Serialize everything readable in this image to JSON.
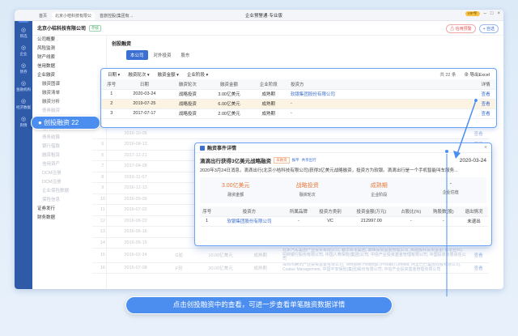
{
  "titlebar": {
    "app_title": "企业预警通·专业版",
    "tabs": [
      {
        "label": "首页"
      },
      {
        "label": "北京小桔科技有限公"
      },
      {
        "label": "首旅控股(集团有…"
      }
    ],
    "vip": "VIP专"
  },
  "leftbar": {
    "items": [
      {
        "label": "目选",
        "icon": "target-icon"
      },
      {
        "label": "企业",
        "icon": "building-icon"
      },
      {
        "label": "债券",
        "icon": "bond-icon"
      },
      {
        "label": "金融机构",
        "icon": "bank-icon"
      },
      {
        "label": "经济数据",
        "icon": "chart-icon"
      },
      {
        "label": "舆情",
        "icon": "news-icon"
      }
    ]
  },
  "company": {
    "name": "北京小桔科技有限公司",
    "status": "存续",
    "btn_warning": "信用预警",
    "btn_add": "自选"
  },
  "sidebar": {
    "items": [
      {
        "label": "公司概要",
        "sub": false
      },
      {
        "label": "风险监测",
        "sub": false
      },
      {
        "label": "财产线索",
        "sub": false
      },
      {
        "label": "信用数据",
        "sub": false
      },
      {
        "label": "企业融资",
        "sub": false
      },
      {
        "label": "融资图谱",
        "sub": true
      },
      {
        "label": "融资清单",
        "sub": true
      },
      {
        "label": "融资分析",
        "sub": true
      },
      {
        "label": "债券融资",
        "sub": true
      },
      {
        "label": "债券发行",
        "sub": true
      },
      {
        "label": "信托融资",
        "sub": true
      },
      {
        "label": "债务结算",
        "sub": true
      },
      {
        "label": "银行借款",
        "sub": true
      },
      {
        "label": "融资租赁",
        "sub": true
      },
      {
        "label": "信用资产",
        "sub": true
      },
      {
        "label": "DCM注册",
        "sub": true
      },
      {
        "label": "DCM注册",
        "sub": true
      },
      {
        "label": "企业保险数据",
        "sub": true
      },
      {
        "label": "保险信息",
        "sub": true
      },
      {
        "label": "证券发行",
        "sub": false
      },
      {
        "label": "财务数据",
        "sub": false
      }
    ],
    "callout": "创投融资 22"
  },
  "main": {
    "section_title": "创投融资",
    "subtabs": [
      "本公司",
      "对外投资",
      "股东"
    ],
    "filters": [
      "日期",
      "融资轮次",
      "融资金额",
      "企业阶段"
    ],
    "count_label": "共 22 条",
    "export_label": "导出Excel",
    "table_headers": [
      "序号",
      "日期",
      "融资轮次",
      "融资金额",
      "企业阶段",
      "投资方",
      "详情"
    ],
    "rows": [
      {
        "no": "1",
        "date": "2020-03-24",
        "round": "战略投资",
        "amount": "3.00亿美元",
        "stage": "成熟期",
        "investor": "软银集团股份有限公司",
        "detail": "查看"
      },
      {
        "no": "2",
        "date": "2019-07-25",
        "round": "战略投资",
        "amount": "6.00亿美元",
        "stage": "成熟期",
        "investor": "-",
        "detail": "查看"
      },
      {
        "no": "3",
        "date": "2017-07-17",
        "round": "战略投资",
        "amount": "2.00亿美元",
        "stage": "成熟期",
        "investor": "-",
        "detail": "查看"
      }
    ],
    "bg_rows": [
      {
        "no": "",
        "date": "2016-10-05",
        "round": "",
        "amount": "",
        "stage": "",
        "investor": "",
        "detail": "查看"
      },
      {
        "no": "5",
        "date": "2016-08-13",
        "round": "",
        "amount": "",
        "stage": "",
        "investor": "",
        "detail": "查看"
      },
      {
        "no": "6",
        "date": "2017-12-21",
        "round": "",
        "amount": "",
        "stage": "",
        "investor": "",
        "detail": "查看"
      },
      {
        "no": "7",
        "date": "2017-04-28",
        "round": "",
        "amount": "",
        "stage": "",
        "investor": "",
        "detail": "查看"
      },
      {
        "no": "8",
        "date": "2016-11-07",
        "round": "",
        "amount": "",
        "stage": "",
        "investor": "",
        "detail": "查看"
      },
      {
        "no": "9",
        "date": "2016-12-13",
        "round": "",
        "amount": "",
        "stage": "",
        "investor": "",
        "detail": "查看"
      },
      {
        "no": "10",
        "date": "2016-09-09",
        "round": "",
        "amount": "",
        "stage": "",
        "investor": "",
        "detail": "查看"
      },
      {
        "no": "11",
        "date": "2016-07-02",
        "round": "",
        "amount": "",
        "stage": "",
        "investor": "",
        "detail": "查看"
      },
      {
        "no": "12",
        "date": "2016-06-22",
        "round": "",
        "amount": "",
        "stage": "",
        "investor": "",
        "detail": "查看"
      },
      {
        "no": "13",
        "date": "2016-06-16",
        "round": "",
        "amount": "",
        "stage": "",
        "investor": "",
        "detail": "查看"
      },
      {
        "no": "14",
        "date": "2016-05-15",
        "round": "",
        "amount": "",
        "stage": "",
        "investor": "",
        "detail": "查看"
      },
      {
        "no": "15",
        "date": "2016-02-24",
        "round": "G轮",
        "amount": "10.00亿美元",
        "stage": "成熟期",
        "investor": "北京汽车集团产业投资有限公司, 春华资本集团, 鼎晖投资基金管理公司, 民航股权投资基金(有限合伙), 招商银行股份有限公司, 中国人寿保险(集团)公司, 中信产业投资基金管理有限公司, 中国投资有限责任公司",
        "detail": "查看"
      },
      {
        "no": "16",
        "date": "2015-07-08",
        "round": "F轮",
        "amount": "30.00亿美元",
        "stage": "成熟期",
        "investor": "深圳市腾讯产业投资基金有限公司, Temasek Holdings (Private) Limited, 阿里巴巴集团控股有限公司, Coatue Management, 中国平安保险(集团)股份有限公司, 中信产业投资基金管理有限公司",
        "detail": "查看"
      }
    ]
  },
  "modal": {
    "header": "融资事件详情",
    "title": "滴滴出行获得3亿美元战略融资",
    "tag1": "未融资",
    "tag2": "报平",
    "tag3": "共享出行",
    "date": "2020-03-24",
    "desc": "2020年3月24日消息，滴滴出行(北京小桔科技有限公司)获得3亿美元战略融资，投资方为软银。滴滴出行是一个手机智能叫车服务...",
    "stats": [
      {
        "value": "3.00亿美元",
        "label": "融资金额",
        "gray": false
      },
      {
        "value": "战略投资",
        "label": "融资轮次",
        "gray": false
      },
      {
        "value": "成熟期",
        "label": "企业阶段",
        "gray": false
      },
      {
        "value": "-",
        "label": "企业估值",
        "gray": true
      }
    ],
    "table_headers": [
      "序号",
      "投资方",
      "所属品牌",
      "投资方类别",
      "投资金额(万元)",
      "占股比(%)",
      "购股数(股)",
      "退出情况"
    ],
    "rows": [
      {
        "no": "1",
        "investor": "软银集团股份有限公司",
        "brand": "-",
        "type": "VC",
        "amount": "212997.00",
        "ratio": "-",
        "shares": "-",
        "exit": "未退出"
      }
    ]
  },
  "bottom_callout": "点击创投融资中的查看，可进一步查看单笔融资数据详情"
}
